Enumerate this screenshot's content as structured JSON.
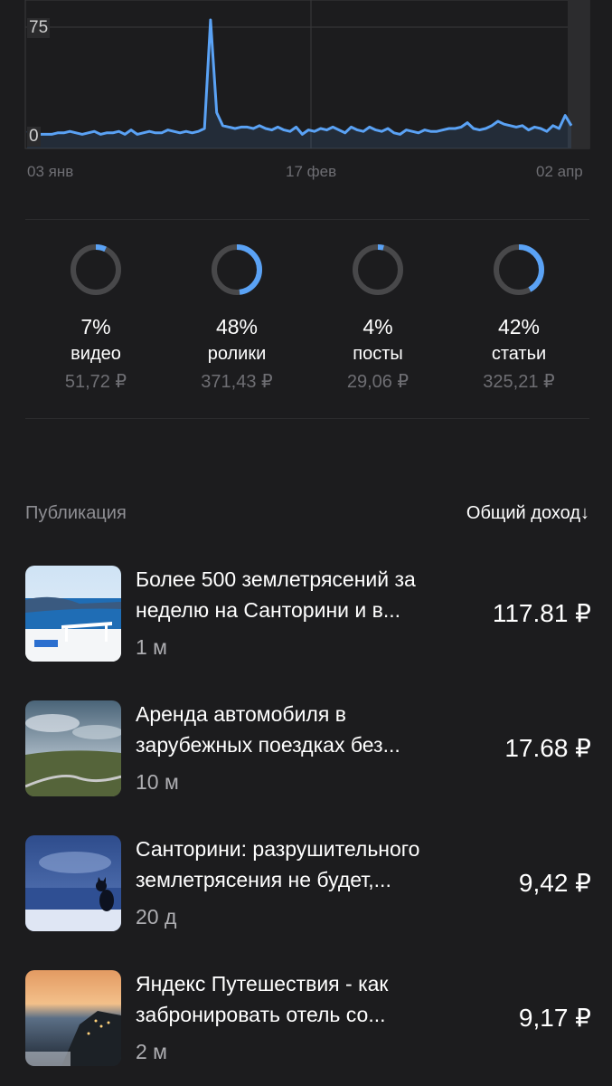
{
  "chart": {
    "y_ticks": [
      "75",
      "0"
    ],
    "x_ticks": [
      "03 янв",
      "17 фев",
      "02 апр"
    ],
    "line_color": "#5aa2f5",
    "chart_data": {
      "type": "line",
      "x_start": "03 янв",
      "x_end": "02 апр",
      "ylim": [
        0,
        75
      ],
      "values": [
        2,
        3,
        1,
        1,
        1,
        2,
        2,
        3,
        2,
        1,
        2,
        3,
        1,
        2,
        2,
        3,
        1,
        4,
        1,
        2,
        3,
        2,
        2,
        4,
        3,
        2,
        3,
        2,
        3,
        5,
        80,
        16,
        7,
        6,
        5,
        6,
        6,
        5,
        7,
        5,
        4,
        6,
        4,
        3,
        6,
        1,
        4,
        3,
        5,
        4,
        6,
        4,
        2,
        6,
        4,
        3,
        6,
        4,
        3,
        5,
        2,
        1,
        4,
        3,
        2,
        4,
        3,
        3,
        4,
        5,
        5,
        6,
        9,
        5,
        4,
        5,
        7,
        10,
        8,
        7,
        6,
        7,
        4,
        6,
        5,
        3,
        7,
        5,
        14,
        7
      ]
    }
  },
  "breakdown": [
    {
      "percent": "7%",
      "label": "видео",
      "value": "51,72 ₽",
      "fraction": 0.07
    },
    {
      "percent": "48%",
      "label": "ролики",
      "value": "371,43 ₽",
      "fraction": 0.48
    },
    {
      "percent": "4%",
      "label": "посты",
      "value": "29,06 ₽",
      "fraction": 0.04
    },
    {
      "percent": "42%",
      "label": "статьи",
      "value": "325,21 ₽",
      "fraction": 0.42
    }
  ],
  "publications": {
    "column_left": "Публикация",
    "column_right": "Общий доход↓",
    "items": [
      {
        "title_line1": "Более 500 землетрясений за",
        "title_line2": "неделю на Санторини и в...",
        "age": "1 м",
        "income": "117.81 ₽"
      },
      {
        "title_line1": "Аренда автомобиля в",
        "title_line2": "зарубежных поездках без...",
        "age": "10 м",
        "income": "17.68 ₽"
      },
      {
        "title_line1": "Санторини: разрушительного",
        "title_line2": "землетрясения не будет,...",
        "age": "20 д",
        "income": "9,42 ₽"
      },
      {
        "title_line1": "Яндекс Путешествия - как",
        "title_line2": "забронировать отель со...",
        "age": "2 м",
        "income": "9,17 ₽"
      }
    ]
  },
  "colors": {
    "background": "#1c1c1e",
    "accent": "#5aa2f5",
    "ring_track": "#48484a",
    "muted_text": "#6e6e73"
  }
}
